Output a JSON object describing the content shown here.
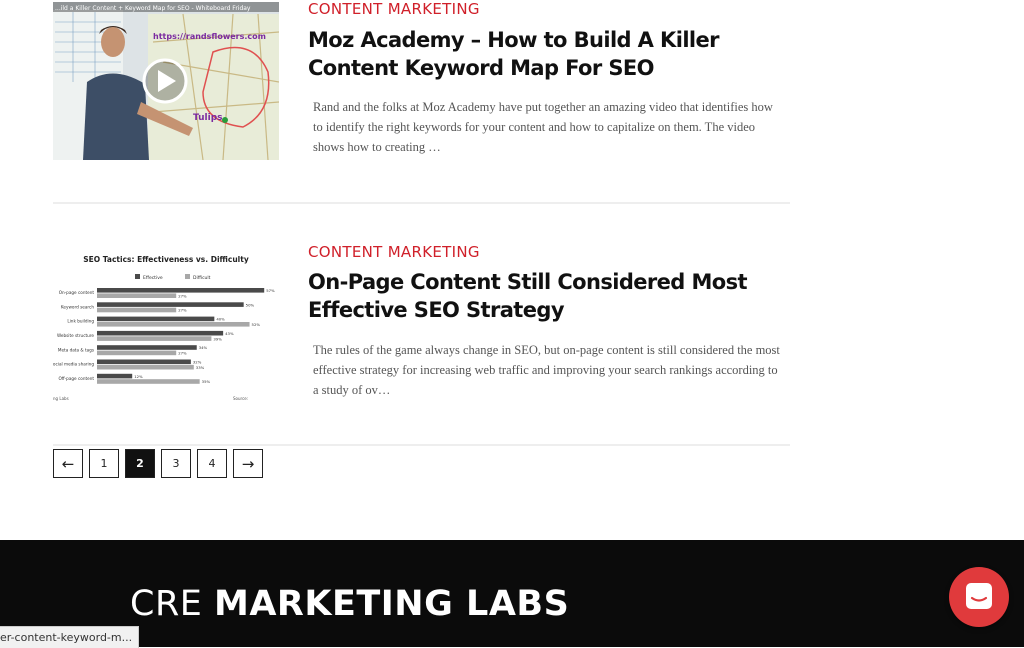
{
  "posts": [
    {
      "category": "CONTENT MARKETING",
      "title": "Moz Academy – How to Build A Killer Content Keyword Map For SEO",
      "excerpt": "Rand and the folks at Moz Academy have put together an amazing video that identifies how to identify the right keywords for your content and how to capitalize on them. The video shows how to creating …",
      "thumb": {
        "video_title": "...ild a Killer Content + Keyword Map for SEO - Whiteboard Friday",
        "url_text": "https://randsflowers.com",
        "map_label": "Tulips"
      }
    },
    {
      "category": "CONTENT MARKETING",
      "title": "On-Page Content Still Considered Most Effective SEO Strategy",
      "excerpt": "The rules of the game always change in SEO, but on-page content is still considered the most effective strategy for increasing web traffic and improving your search rankings according to a study of ov…",
      "thumb": {
        "chart_title": "SEO Tactics: Effectiveness vs. Difficulty",
        "legend_effective": "Effective",
        "legend_difficult": "Difficult",
        "footer_left": "ng Labs",
        "footer_right": "Source:"
      }
    }
  ],
  "pagination": {
    "prev": "←",
    "pages": [
      "1",
      "2",
      "3",
      "4"
    ],
    "current": "2",
    "next": "→"
  },
  "footer": {
    "logo_light": "CRE",
    "logo_bold": "MARKETING LABS"
  },
  "status_bar": "er-content-keyword-m...",
  "colors": {
    "accent": "#d0202a",
    "footer_bg": "#0b0b0b",
    "chat_button": "#e03a3c"
  },
  "chart_data": {
    "type": "bar",
    "title": "SEO Tactics: Effectiveness vs. Difficulty",
    "categories": [
      "On-page content",
      "Keyword search",
      "Link building",
      "Website structure",
      "Meta data & tags",
      "Social media sharing",
      "Off-page content"
    ],
    "series": [
      {
        "name": "Effective",
        "values": [
          57,
          50,
          40,
          43,
          34,
          32,
          12
        ]
      },
      {
        "name": "Difficult",
        "values": [
          27,
          27,
          52,
          39,
          27,
          33,
          35
        ]
      }
    ],
    "xlim": [
      0,
      60
    ]
  }
}
